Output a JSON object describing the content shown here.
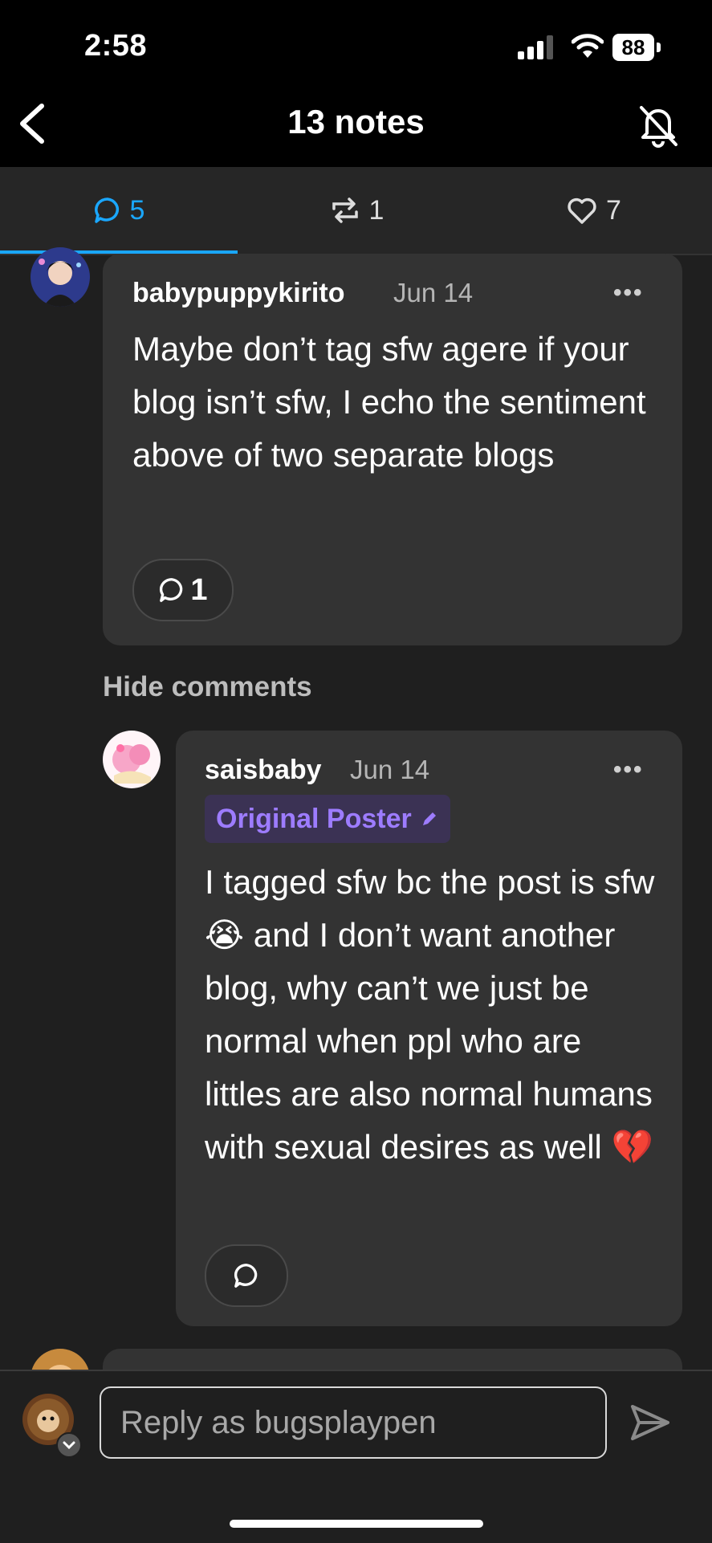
{
  "status_bar": {
    "time": "2:58",
    "battery": "88"
  },
  "header": {
    "title": "13 notes"
  },
  "tabs": [
    {
      "name": "comments",
      "count": "5"
    },
    {
      "name": "reblogs",
      "count": "1"
    },
    {
      "name": "likes",
      "count": "7"
    }
  ],
  "comments": [
    {
      "username": "babypuppykirito",
      "date": "Jun 14",
      "more": "•••",
      "body": "Maybe don’t tag sfw agere if your blog isn’t sfw, I echo the sentiment above of two separate blogs",
      "reply_count": "1"
    }
  ],
  "hide_comments_label": "Hide comments",
  "replies": [
    {
      "username": "saisbaby",
      "date": "Jun 14",
      "more": "•••",
      "badge": "Original Poster",
      "body": "I tagged sfw bc the post is sfw 😭 and I don’t want another blog, why can’t we just be normal when ppl who are littles are also normal humans with sexual desires as well 💔"
    }
  ],
  "reply_bar": {
    "placeholder": "Reply as bugsplaypen"
  },
  "colors": {
    "accent": "#1aa7ff",
    "op_badge": "#9d7cff",
    "card": "#333333"
  }
}
